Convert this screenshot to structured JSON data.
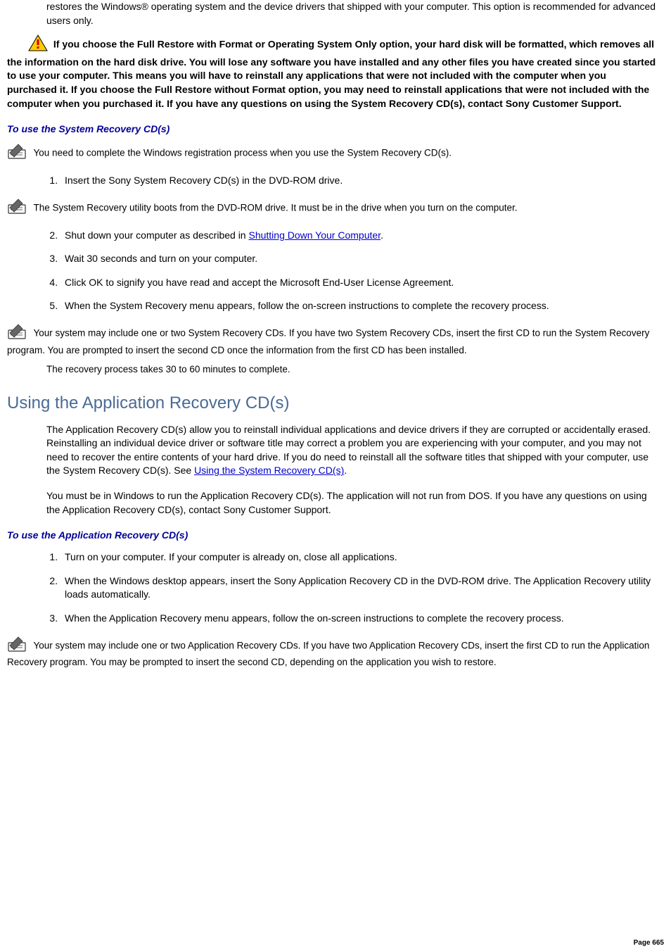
{
  "intro_para": "restores the Windows® operating system and the device drivers that shipped with your computer. This option is recommended for advanced users only.",
  "warning": " If you choose the Full Restore with Format or Operating System Only option, your hard disk will be formatted, which removes all the information on the hard disk drive. You will lose any software you have installed and any other files you have created since you started to use your computer. This means you will have to reinstall any applications that were not included with the computer when you purchased it. If you choose the Full Restore without Format option, you may need to reinstall applications that were not included with the computer when you purchased it. If you have any questions on using the System Recovery CD(s), contact Sony Customer Support.",
  "sec1_heading": "To use the System Recovery CD(s)",
  "note1": " You need to complete the Windows registration process when you use the System Recovery CD(s).",
  "list1_item1": "Insert the Sony System Recovery CD(s) in the DVD-ROM drive.",
  "note2": " The System Recovery utility boots from the DVD-ROM drive. It must be in the drive when you turn on the computer.",
  "list1_item2_pre": "Shut down your computer as described in ",
  "list1_item2_link": "Shutting Down Your Computer",
  "list1_item2_post": ".",
  "list1_item3": "Wait 30 seconds and turn on your computer.",
  "list1_item4": "Click OK to signify you have read and accept the Microsoft End-User License Agreement.",
  "list1_item5": "When the System Recovery menu appears, follow the on-screen instructions to complete the recovery process.",
  "note3": " Your system may include one or two System Recovery CDs. If you have two System Recovery CDs, insert the first CD to run the System Recovery program. You are prompted to insert the second CD once the information from the first CD has been installed.",
  "note4": "The recovery process takes 30 to 60 minutes to complete.",
  "sec2_heading": "Using the Application Recovery CD(s)",
  "sec2_para1_pre": "The Application Recovery CD(s) allow you to reinstall individual applications and device drivers if they are corrupted or accidentally erased. Reinstalling an individual device driver or software title may correct a problem you are experiencing with your computer, and you may not need to recover the entire contents of your hard drive. If you do need to reinstall all the software titles that shipped with your computer, use the System Recovery CD(s). See ",
  "sec2_para1_link": "Using the System Recovery CD(s)",
  "sec2_para1_post": ".",
  "sec2_para2": "You must be in Windows to run the Application Recovery CD(s). The application will not run from DOS. If you have any questions on using the Application Recovery CD(s), contact Sony Customer Support.",
  "sec3_heading": "To use the Application Recovery CD(s)",
  "list2_item1": "Turn on your computer. If your computer is already on, close all applications.",
  "list2_item2": "When the Windows desktop appears, insert the Sony Application Recovery CD in the DVD-ROM drive. The Application Recovery utility loads automatically.",
  "list2_item3": "When the Application Recovery menu appears, follow the on-screen instructions to complete the recovery process.",
  "note5": " Your system may include one or two Application Recovery CDs. If you have two Application Recovery CDs, insert the first CD to run the Application Recovery program. You may be prompted to insert the second CD, depending on the application you wish to restore.",
  "page_number": "Page 665"
}
